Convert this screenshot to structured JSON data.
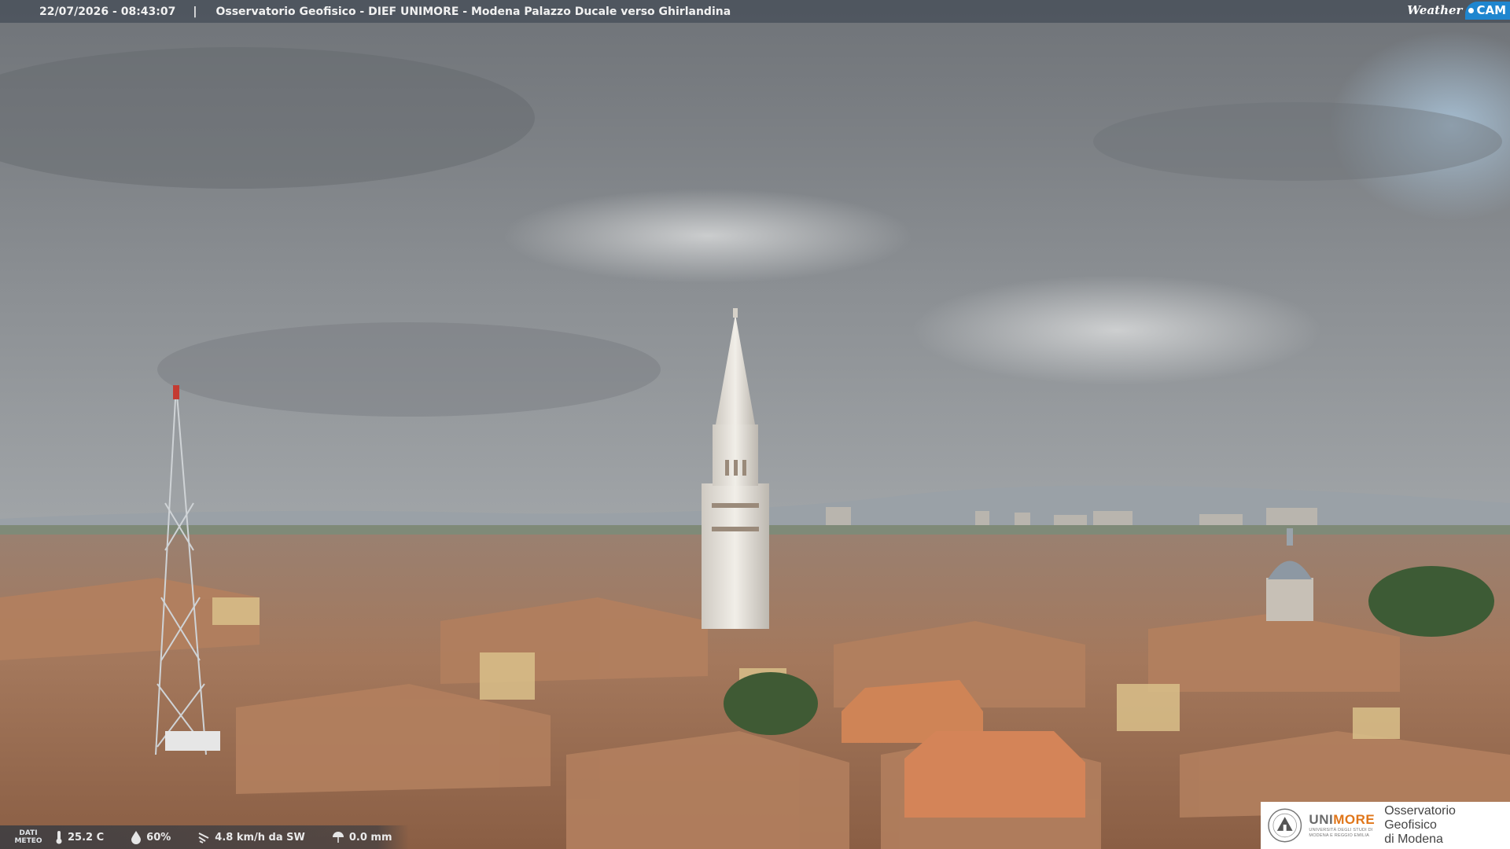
{
  "header": {
    "timestamp": "22/07/2026 - 08:43:07",
    "separator": "|",
    "location_title": "Osservatorio Geofisico - DIEF UNIMORE - Modena Palazzo Ducale verso Ghirlandina"
  },
  "brand": {
    "weather": "Weather",
    "cam": "CAM",
    "color": "#1f86cf"
  },
  "weather": {
    "dati_line1": "DATI",
    "dati_line2": "METEO",
    "temperature": "25.2 C",
    "humidity": "60%",
    "wind": "4.8 km/h da SW",
    "rain": "0.0 mm"
  },
  "sponsor": {
    "name_part1": "UNI",
    "name_part2": "MORE",
    "university_line1": "UNIVERSITÀ DEGLI STUDI DI",
    "university_line2": "MODENA E REGGIO EMILIA",
    "observatory_line1": "Osservatorio Geofisico",
    "observatory_line2": "di Modena",
    "accent_color": "#e0761a"
  }
}
